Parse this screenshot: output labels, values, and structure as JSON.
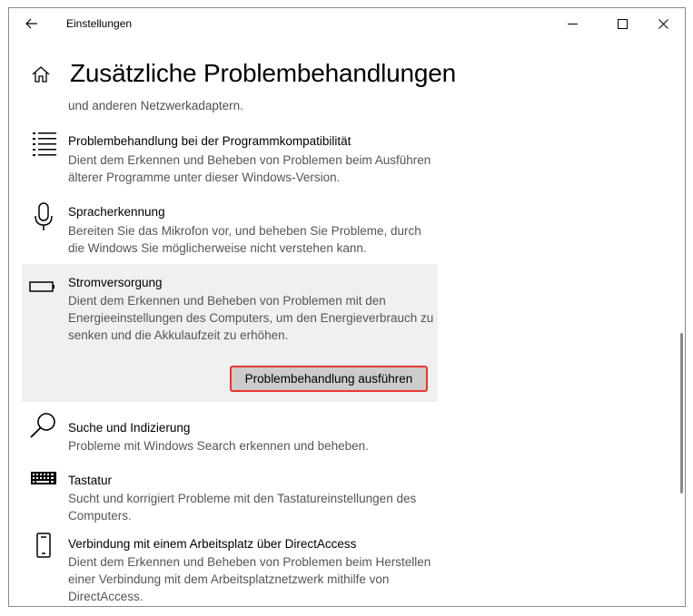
{
  "window": {
    "app_title": "Einstellungen"
  },
  "page": {
    "title": "Zusätzliche Problembehandlungen",
    "cut_off_text": "und anderen Netzwerkadaptern."
  },
  "items": [
    {
      "name": "Problembehandlung bei der Programmkompatibilität",
      "desc": "Dient dem Erkennen und Beheben von Problemen beim Ausführen älterer Programme unter dieser Windows-Version.",
      "icon": "list-icon"
    },
    {
      "name": "Spracherkennung",
      "desc": "Bereiten Sie das Mikrofon vor, und beheben Sie Probleme, durch die Windows Sie möglicherweise nicht verstehen kann.",
      "icon": "microphone-icon"
    },
    {
      "name": "Stromversorgung",
      "desc": "Dient dem Erkennen und Beheben von Problemen mit den Energieeinstellungen des Computers, um den Energieverbrauch zu senken und die Akkulaufzeit zu erhöhen.",
      "icon": "battery-icon",
      "selected": true,
      "button_label": "Problembehandlung ausführen"
    },
    {
      "name": "Suche und Indizierung",
      "desc": "Probleme mit Windows Search erkennen und beheben.",
      "icon": "search-icon"
    },
    {
      "name": "Tastatur",
      "desc": "Sucht und korrigiert Probleme mit den Tastatureinstellungen des Computers.",
      "icon": "keyboard-icon"
    },
    {
      "name": "Verbindung mit einem Arbeitsplatz über DirectAccess",
      "desc": "Dient dem Erkennen und Beheben von Problemen beim Herstellen einer Verbindung mit dem Arbeitsplatznetzwerk mithilfe von DirectAccess.",
      "icon": "phone-icon"
    }
  ],
  "colors": {
    "selected_bg": "#f0f0f0",
    "button_bg": "#cccccc",
    "highlight_border": "#e8372c"
  }
}
